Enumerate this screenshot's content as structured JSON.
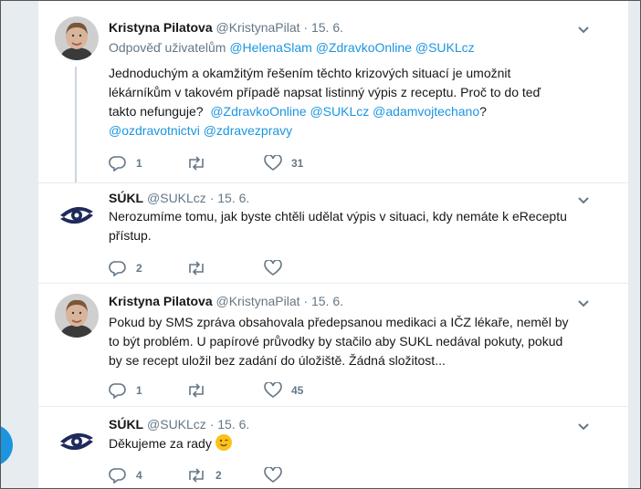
{
  "tweets": [
    {
      "name": "Kristyna Pilatova",
      "handle": "@KristynaPilat",
      "separator": "·",
      "date": "15. 6.",
      "avatar": "woman-photo-avatar",
      "reply_prefix": "Odpověď uživatelům",
      "reply_mentions": [
        "@HelenaSlam",
        "@ZdravkoOnline",
        "@SUKLcz"
      ],
      "text_lines": [
        "Jednoduchým a okamžitým řešením těchto krizových situací je umožnit",
        "lékárníkům v takovém případě napsat listinný výpis z receptu. Proč to do teď"
      ],
      "text_line3_prefix": "takto nefunguje?",
      "text_line3_mentions": [
        "@ZdravkoOnline",
        "@SUKLcz",
        "@adamvojtechano"
      ],
      "text_line3_suffix": "?",
      "text_line4_mentions": [
        "@ozdravotnictvi",
        "@zdravezpravy"
      ],
      "replies": "1",
      "retweets": "",
      "likes": "31"
    },
    {
      "name": "SÚKL",
      "handle": "@SUKLcz",
      "separator": "·",
      "date": "15. 6.",
      "avatar": "sukl-logo-avatar",
      "text_lines": [
        "Nerozumíme tomu, jak byste chtěli udělat výpis v situaci, kdy nemáte k eReceptu",
        "přístup."
      ],
      "replies": "2",
      "retweets": "",
      "likes": ""
    },
    {
      "name": "Kristyna Pilatova",
      "handle": "@KristynaPilat",
      "separator": "·",
      "date": "15. 6.",
      "avatar": "woman-photo-avatar",
      "text_lines": [
        "Pokud by SMS zpráva obsahovala předepsanou medikaci a IČZ lékaře, neměl by",
        "to být problém. U papírové průvodky by stačilo aby SUKL nedával pokuty, pokud",
        "by se recept uložil bez zadání do úložiště. Žádná složitost..."
      ],
      "replies": "1",
      "retweets": "",
      "likes": "45"
    },
    {
      "name": "SÚKL",
      "handle": "@SUKLcz",
      "separator": "·",
      "date": "15. 6.",
      "avatar": "sukl-logo-avatar",
      "text_lines": [
        "Děkujeme za rady"
      ],
      "emoji": "winking-face-emoji",
      "replies": "4",
      "retweets": "2",
      "likes": ""
    }
  ],
  "icons": {
    "reply": "reply-icon",
    "retweet": "retweet-icon",
    "like": "heart-icon",
    "menu": "chevron-down-icon"
  },
  "colors": {
    "link": "#1b95e0",
    "text": "#14171a",
    "muted": "#657786",
    "thread_line": "#ccd6dd",
    "background": "#e6ecf0"
  }
}
